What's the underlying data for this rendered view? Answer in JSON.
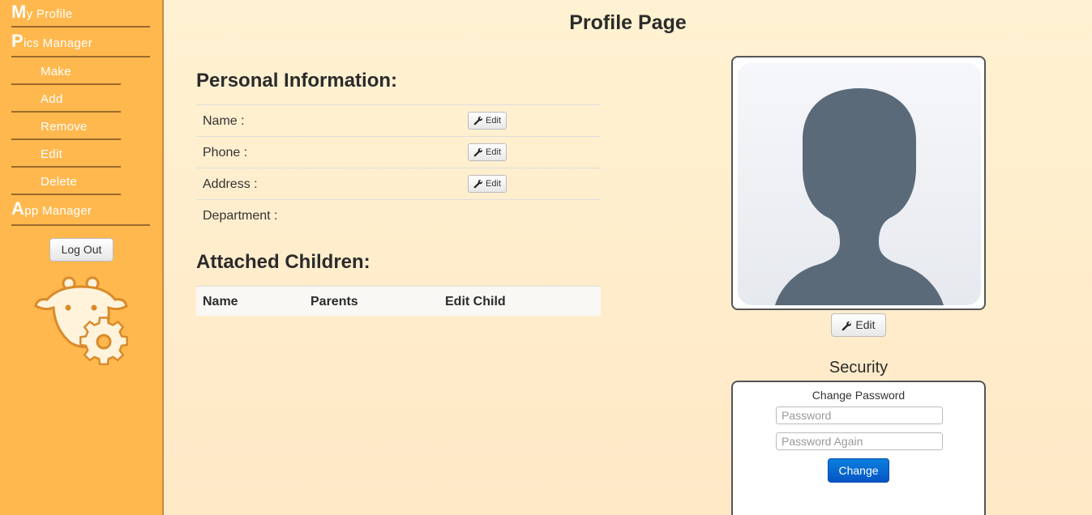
{
  "sidebar": {
    "items": [
      {
        "initial": "M",
        "rest": "y Profile"
      },
      {
        "initial": "P",
        "rest": "ics Manager"
      },
      {
        "label": "Make"
      },
      {
        "label": "Add"
      },
      {
        "label": "Remove"
      },
      {
        "label": "Edit"
      },
      {
        "label": "Delete"
      },
      {
        "initial": "A",
        "rest": "pp Manager"
      }
    ],
    "logout_label": "Log Out"
  },
  "page_title": "Profile Page",
  "personal": {
    "heading": "Personal Information:",
    "rows": [
      {
        "label": "Name :",
        "edit_label": "Edit"
      },
      {
        "label": "Phone :",
        "edit_label": "Edit"
      },
      {
        "label": "Address :",
        "edit_label": "Edit"
      },
      {
        "label": "Department :"
      }
    ]
  },
  "children": {
    "heading": "Attached Children:",
    "columns": [
      "Name",
      "Parents",
      "Edit Child"
    ]
  },
  "avatar": {
    "edit_label": "Edit"
  },
  "security": {
    "title": "Security",
    "change_password_label": "Change Password",
    "password_placeholder": "Password",
    "password_again_placeholder": "Password Again",
    "change_label": "Change"
  },
  "colors": {
    "sidebar": "#ffb84e",
    "primary_button": "#0666d0",
    "avatar_silhouette": "#5a6a78"
  }
}
